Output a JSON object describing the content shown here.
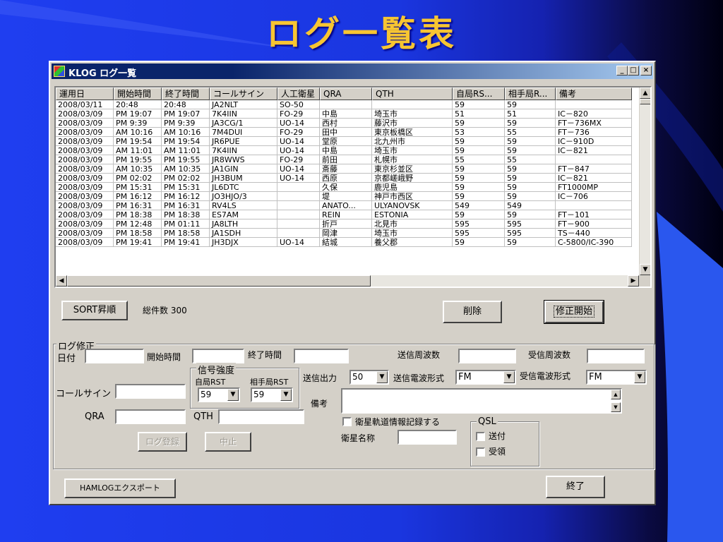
{
  "slide": {
    "title": "ログ一覧表"
  },
  "window": {
    "title": "KLOG  ログ一覧",
    "controls": {
      "minimize": "_",
      "maximize": "□",
      "close": "×"
    }
  },
  "log_table": {
    "columns": [
      "運用日",
      "開始時間",
      "終了時間",
      "コールサイン",
      "人工衛星",
      "QRA",
      "QTH",
      "自局RS...",
      "相手局R...",
      "備考"
    ],
    "rows": [
      [
        "2008/03/11",
        "20:48",
        "20:48",
        "JA2NLT",
        "SO-50",
        "",
        "",
        "59",
        "59",
        ""
      ],
      [
        "2008/03/09",
        "PM 19:07",
        "PM 19:07",
        "7K4IIN",
        "FO-29",
        "中島",
        "埼玉市",
        "51",
        "51",
        "IC－820"
      ],
      [
        "2008/03/09",
        "PM 9:39",
        "PM 9:39",
        "JA3CG/1",
        "UO-14",
        "西村",
        "藤沢市",
        "59",
        "59",
        "FT－736MX"
      ],
      [
        "2008/03/09",
        "AM 10:16",
        "AM 10:16",
        "7M4DUI",
        "FO-29",
        "田中",
        "東京板橋区",
        "53",
        "55",
        "FT－736"
      ],
      [
        "2008/03/09",
        "PM 19:54",
        "PM 19:54",
        "JR6PUE",
        "UO-14",
        "堂原",
        "北九州市",
        "59",
        "59",
        "IC－910D"
      ],
      [
        "2008/03/09",
        "AM 11:01",
        "AM 11:01",
        "7K4IIN",
        "UO-14",
        "中島",
        "埼玉市",
        "59",
        "59",
        "IC－821"
      ],
      [
        "2008/03/09",
        "PM 19:55",
        "PM 19:55",
        "JR8WWS",
        "FO-29",
        "前田",
        "札幌市",
        "55",
        "55",
        ""
      ],
      [
        "2008/03/09",
        "AM 10:35",
        "AM 10:35",
        "JA1GIN",
        "UO-14",
        "斎藤",
        "東京杉並区",
        "59",
        "59",
        "FT－847"
      ],
      [
        "2008/03/09",
        "PM 02:02",
        "PM 02:02",
        "JH3BUM",
        "UO-14",
        "西原",
        "京都嵯峨野",
        "59",
        "59",
        "IC－821"
      ],
      [
        "2008/03/09",
        "PM 15:31",
        "PM 15:31",
        "JL6DTC",
        "",
        "久保",
        "鹿児島",
        "59",
        "59",
        "FT1000MP"
      ],
      [
        "2008/03/09",
        "PM 16:12",
        "PM 16:12",
        "JO3HJO/3",
        "",
        "堤",
        "神戸市西区",
        "59",
        "59",
        "IC－706"
      ],
      [
        "2008/03/09",
        "PM 16:31",
        "PM 16:31",
        "RV4LS",
        "",
        "ANATO...",
        "ULYANOVSK",
        "549",
        "549",
        ""
      ],
      [
        "2008/03/09",
        "PM 18:38",
        "PM 18:38",
        "ES7AM",
        "",
        "REIN",
        "ESTONIA",
        "59",
        "59",
        "FT－101"
      ],
      [
        "2008/03/09",
        "PM 12:48",
        "PM 01:11",
        "JA8LTH",
        "",
        "折戸",
        "北見市",
        "595",
        "595",
        "FT－900"
      ],
      [
        "2008/03/09",
        "PM 18:58",
        "PM 18:58",
        "JA1SDH",
        "",
        "岡津",
        "埼玉市",
        "595",
        "595",
        "TS－440"
      ],
      [
        "2008/03/09",
        "PM 19:41",
        "PM 19:41",
        "JH3DJX",
        "UO-14",
        "結城",
        "養父郡",
        "59",
        "59",
        "C-5800/IC-390"
      ]
    ]
  },
  "actions": {
    "sort_label": "SORT昇順",
    "total_label": "総件数 300",
    "delete_label": "削除",
    "edit_label": "修正開始"
  },
  "edit_form": {
    "group_title": "ログ修正",
    "date_label": "日付",
    "start_label": "開始時間",
    "end_label": "終了時間",
    "tx_freq_label": "送信周波数",
    "rx_freq_label": "受信周波数",
    "signal_group_title": "信号強度",
    "my_rst_label": "自局RST",
    "his_rst_label": "相手局RST",
    "my_rst_value": "59",
    "his_rst_value": "59",
    "tx_power_label": "送信出力",
    "tx_power_value": "50",
    "tx_mode_label": "送信電波形式",
    "tx_mode_value": "FM",
    "rx_mode_label": "受信電波形式",
    "rx_mode_value": "FM",
    "callsign_label": "コールサイン",
    "remarks_label": "備考",
    "qra_label": "QRA",
    "qth_label": "QTH",
    "satellite_record_label": "衛星軌道情報記録する",
    "satellite_name_label": "衛星名称",
    "qsl_group_title": "QSL",
    "qsl_sent_label": "送付",
    "qsl_received_label": "受領",
    "register_label": "ログ登録",
    "cancel_label": "中止"
  },
  "footer": {
    "export_label": "HAMLOGエクスポート",
    "exit_label": "終了"
  }
}
